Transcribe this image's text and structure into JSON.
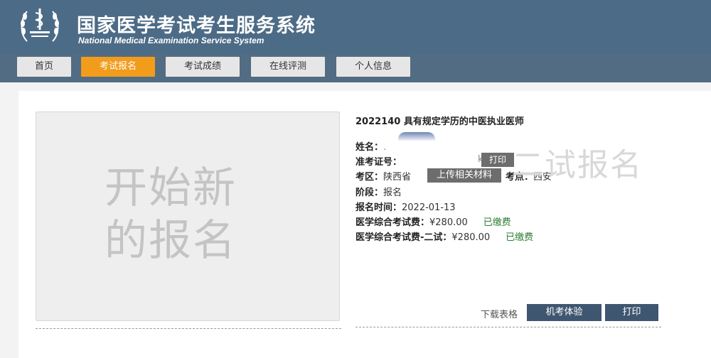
{
  "header": {
    "title_cn": "国家医学考试考生服务系统",
    "title_en": "National Medical Examination Service System"
  },
  "nav": {
    "items": [
      {
        "label": "首页"
      },
      {
        "label": "考试报名"
      },
      {
        "label": "考试成绩"
      },
      {
        "label": "在线评测"
      },
      {
        "label": "个人信息"
      }
    ]
  },
  "new_registration": {
    "line1": "开始新",
    "line2": "的报名"
  },
  "exam": {
    "title": "2022140 具有规定学历的中医执业医师",
    "name_label": "姓名：",
    "name_value": ".",
    "ticket_label": "准考证号：",
    "ticket_fragment": "k",
    "print_label": "打印",
    "district_label": "考区：",
    "district_value": "陕西省",
    "upload_label": "上传相关材料",
    "site_label": "考点：",
    "site_value": "西安",
    "stage_label": "阶段：",
    "stage_value": "报名",
    "time_label": "报名时间：",
    "time_value": "2022-01-13",
    "fee1_label": "医学综合考试费：",
    "fee1_value": "¥280.00",
    "fee1_status": "已缴费",
    "fee2_label": "医学综合考试费-二试：",
    "fee2_value": "¥280.00",
    "fee2_status": "已缴费",
    "watermark": "二试报名"
  },
  "actions": {
    "download_label": "下载表格",
    "computer_exam_label": "机考体验",
    "print_label": "打印"
  }
}
